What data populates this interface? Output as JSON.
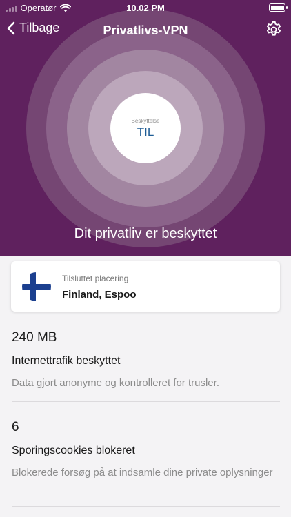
{
  "status_bar": {
    "carrier": "Operatør",
    "time": "10.02 PM",
    "icons": [
      "signal-icon",
      "wifi-icon",
      "battery-icon"
    ]
  },
  "nav": {
    "back_label": "Tilbage",
    "title": "Privatlivs-VPN",
    "settings_icon": "gear-icon"
  },
  "protection": {
    "label": "Beskyttelse",
    "value": "TIL",
    "caption": "Dit privatliv er beskyttet"
  },
  "location": {
    "label": "Tilsluttet placering",
    "value": "Finland, Espoo",
    "flag_icon": "finland-flag-icon"
  },
  "stats": [
    {
      "value": "240 MB",
      "title": "Internettrafik beskyttet",
      "description": "Data gjort anonyme og kontrolleret for trusler."
    },
    {
      "value": "6",
      "title": "Sporingscookies blokeret",
      "description": "Blokerede forsøg på at indsamle dine private oplysninger"
    }
  ],
  "colors": {
    "brand_purple": "#5f215e",
    "protection_value": "#1f5d95",
    "background": "#f4f3f5"
  }
}
